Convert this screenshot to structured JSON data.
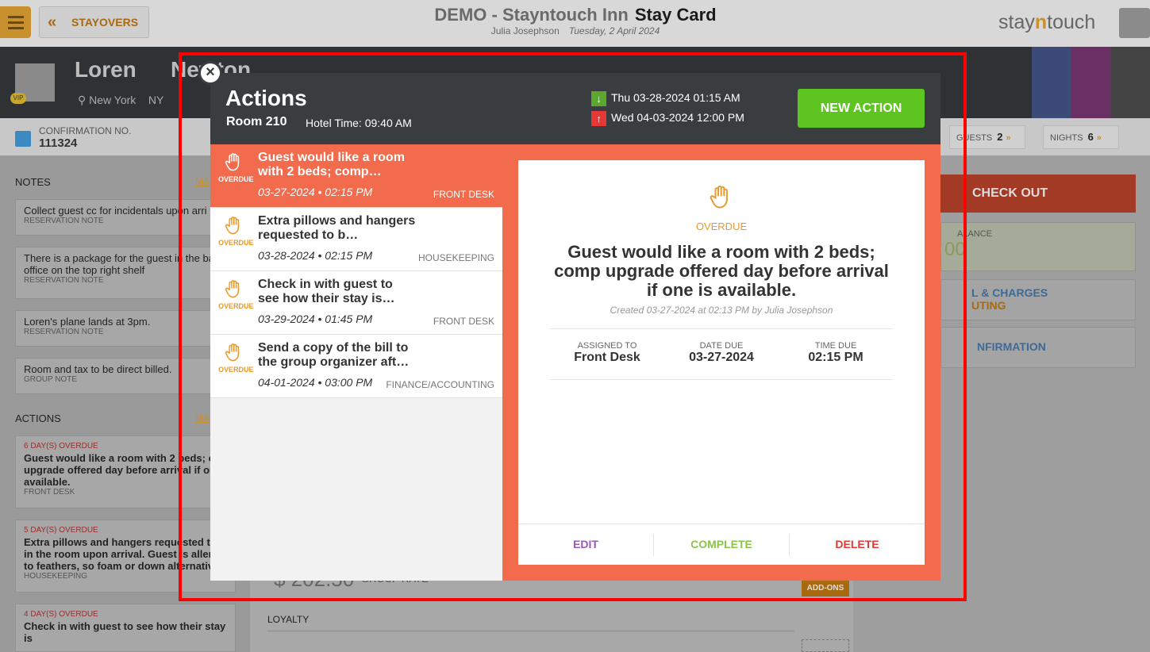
{
  "header": {
    "menu_label": "",
    "back_label": "STAYOVERS",
    "hotel": "DEMO - Stayntouch Inn",
    "page": "Stay Card",
    "user": "Julia Josephson",
    "date": "Tuesday, 2 April 2024",
    "logo_a": "stay",
    "logo_b": "n",
    "logo_c": "touch"
  },
  "guest": {
    "first": "Loren",
    "last": "Newton",
    "city": "New York",
    "state": "NY",
    "vip": "VIP"
  },
  "reservation": {
    "conf_label": "CONFIRMATION NO.",
    "conf_value": "111324",
    "guests_label": "GUESTS",
    "guests_value": "2",
    "nights_label": "NIGHTS",
    "nights_value": "6"
  },
  "notes": {
    "label": "NOTES",
    "more": "MA",
    "items": [
      {
        "text": "Collect guest cc for incidentals upon arri",
        "type": "RESERVATION NOTE"
      },
      {
        "text": "There is a package for the guest in the ba office on the top right shelf",
        "type": "RESERVATION NOTE"
      },
      {
        "text": "Loren's plane lands at 3pm.",
        "type": "RESERVATION NOTE"
      },
      {
        "text": "Room and tax to be direct billed.",
        "type": "GROUP NOTE"
      }
    ]
  },
  "actions_side": {
    "label": "ACTIONS",
    "more": "MA",
    "items": [
      {
        "overdue": "6 DAY(S) OVERDUE",
        "text": "Guest would like a room with 2 beds; co upgrade offered day before arrival if one available.",
        "dept": "FRONT DESK"
      },
      {
        "overdue": "5 DAY(S) OVERDUE",
        "text": "Extra pillows and hangers requested to in the room upon arrival. Guest is allerg to feathers, so foam or down alternative",
        "dept": "HOUSEKEEPING"
      },
      {
        "overdue": "4 DAY(S) OVERDUE",
        "text": "Check in with guest to see how their stay is"
      }
    ]
  },
  "right": {
    "checkout": "CHECK OUT",
    "balance": "ALANCE",
    "balance_val": "00",
    "charges": "L & CHARGES",
    "routing": "UTING",
    "info": "NFIRMATION",
    "rate": "$ 202.50",
    "rate_type": "GROUP RATE",
    "addons": "ADD-ONS",
    "loyalty": "LOYALTY"
  },
  "modal": {
    "title": "Actions",
    "room": "Room 210",
    "hotel_time": "Hotel Time: 09:40 AM",
    "arrival": "Thu 03-28-2024 01:15 AM",
    "departure": "Wed 04-03-2024 12:00 PM",
    "new_action": "NEW ACTION",
    "items": [
      {
        "title": "Guest would like a room with 2 beds; comp…",
        "date": "03-27-2024 • 02:15 PM",
        "dept": "FRONT DESK",
        "status": "OVERDUE"
      },
      {
        "title": "Extra pillows and hangers requested to b…",
        "date": "03-28-2024 • 02:15 PM",
        "dept": "HOUSEKEEPING",
        "status": "OVERDUE"
      },
      {
        "title": "Check in with guest to see how their stay is…",
        "date": "03-29-2024 • 01:45 PM",
        "dept": "FRONT DESK",
        "status": "OVERDUE"
      },
      {
        "title": "Send a copy of the bill to the group organizer aft…",
        "date": "04-01-2024 • 03:00 PM",
        "dept": "FINANCE/ACCOUNTING",
        "status": "OVERDUE"
      }
    ],
    "detail": {
      "status": "OVERDUE",
      "title": "Guest would like a room with 2 beds; comp upgrade offered day before arrival if one is available.",
      "created": "Created 03-27-2024 at 02:13 PM by Julia Josephson",
      "assigned_label": "ASSIGNED TO",
      "assigned": "Front Desk",
      "date_label": "DATE DUE",
      "date": "03-27-2024",
      "time_label": "TIME DUE",
      "time": "02:15 PM",
      "edit": "EDIT",
      "complete": "COMPLETE",
      "delete": "DELETE"
    }
  },
  "colors": {
    "accent": "#f26b4c",
    "green": "#5ec41f",
    "edit": "#9b59b6",
    "complete": "#8bc34a",
    "delete": "#e53935",
    "highlight": "#ff0000"
  }
}
